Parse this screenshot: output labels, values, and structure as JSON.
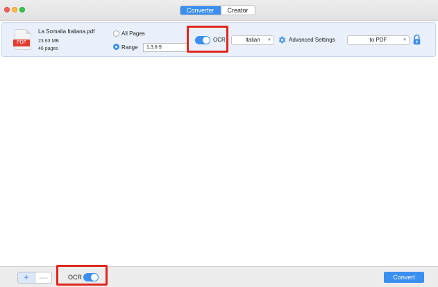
{
  "window": {
    "tabs": [
      {
        "label": "Converter",
        "active": true
      },
      {
        "label": "Creator",
        "active": false
      }
    ]
  },
  "file": {
    "icon_label": "PDF",
    "name": "La Somalia Italiana.pdf",
    "size": "23.63 MB",
    "pages": "46 pages"
  },
  "page_range": {
    "all_label": "All Pages",
    "range_label": "Range",
    "selected": "range",
    "range_value": "1,3,6-9"
  },
  "ocr": {
    "label": "OCR",
    "enabled": true,
    "language": "Italian"
  },
  "advanced_label": "Advanced Settings",
  "output_format": "to PDF",
  "bottom": {
    "plus_label": "+",
    "minus_label": "—",
    "ocr_label": "OCR",
    "ocr_enabled": true,
    "convert_label": "Convert"
  },
  "colors": {
    "accent": "#3a8ff0",
    "highlight": "#e0251b",
    "row_bg": "#e9f0fb",
    "pdf_red": "#e23b2e"
  },
  "icons": [
    "pdf-file-icon",
    "gear-icon",
    "lock-icon",
    "chevron-down-icon"
  ]
}
